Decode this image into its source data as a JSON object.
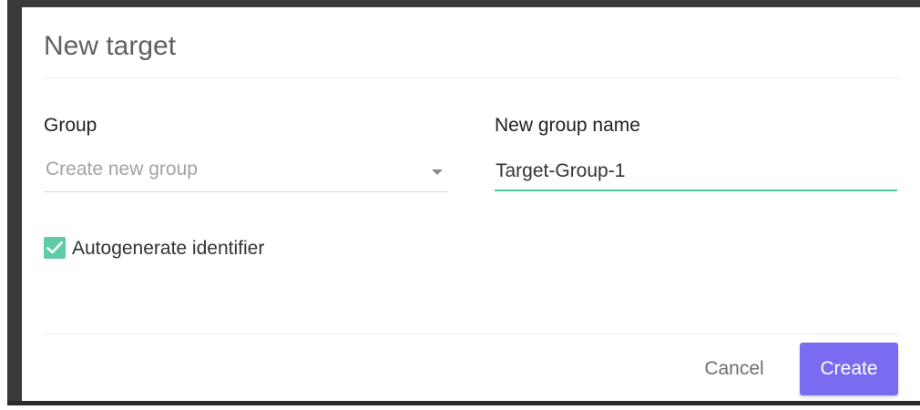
{
  "dialog": {
    "title": "New target"
  },
  "group": {
    "label": "Group",
    "selected_value": "Create new group"
  },
  "new_group_name": {
    "label": "New group name",
    "value": "Target-Group-1"
  },
  "autogenerate": {
    "label": "Autogenerate identifier",
    "checked": true
  },
  "actions": {
    "cancel_label": "Cancel",
    "create_label": "Create"
  },
  "colors": {
    "accent_underline": "#4cc9a2",
    "checkbox": "#5fcba7",
    "primary_button": "#7a6cf0"
  },
  "icons": {
    "checkbox_mark": "check-icon",
    "select_caret": "caret-down-icon"
  }
}
